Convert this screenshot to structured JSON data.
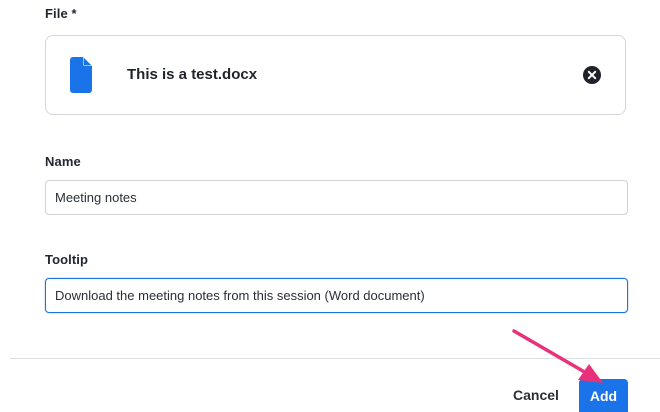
{
  "form": {
    "file_label": "File *",
    "file": {
      "name": "This is a test.docx",
      "icon": "document-icon",
      "remove_icon": "close-circle-icon"
    },
    "name_label": "Name",
    "name_value": "Meeting notes",
    "tooltip_label": "Tooltip",
    "tooltip_value": "Download the meeting notes from this session (Word document)"
  },
  "footer": {
    "cancel_label": "Cancel",
    "add_label": "Add"
  },
  "annotation": {
    "arrow_color": "#e8317a",
    "arrow_target": "add-button"
  },
  "colors": {
    "primary": "#1a73e8",
    "icon_blue": "#1a73e8",
    "text": "#1f2329",
    "border": "#d3d6db"
  }
}
